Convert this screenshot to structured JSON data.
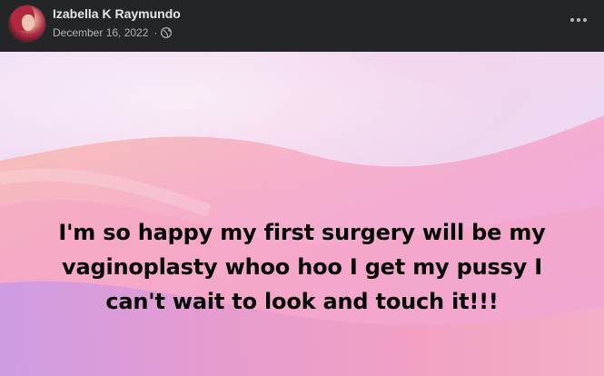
{
  "post": {
    "author": "Izabella K Raymundo",
    "date": "December 16, 2022",
    "separator": "·",
    "audience_icon": "globe-icon",
    "more_icon": "more-options-icon",
    "text_lines": [
      "I'm so happy my first surgery will be my",
      "vaginoplasty whoo hoo I get my pussy I",
      "can't wait to look and touch it!!!"
    ]
  },
  "colors": {
    "header_bg": "#242526",
    "name_text": "#e4e6eb",
    "meta_text": "#b0b3b8",
    "post_text": "#050505",
    "gradient_pink": "#f4a3c4",
    "gradient_lavender": "#eadcf6",
    "gradient_orange": "#f6b0a0"
  }
}
